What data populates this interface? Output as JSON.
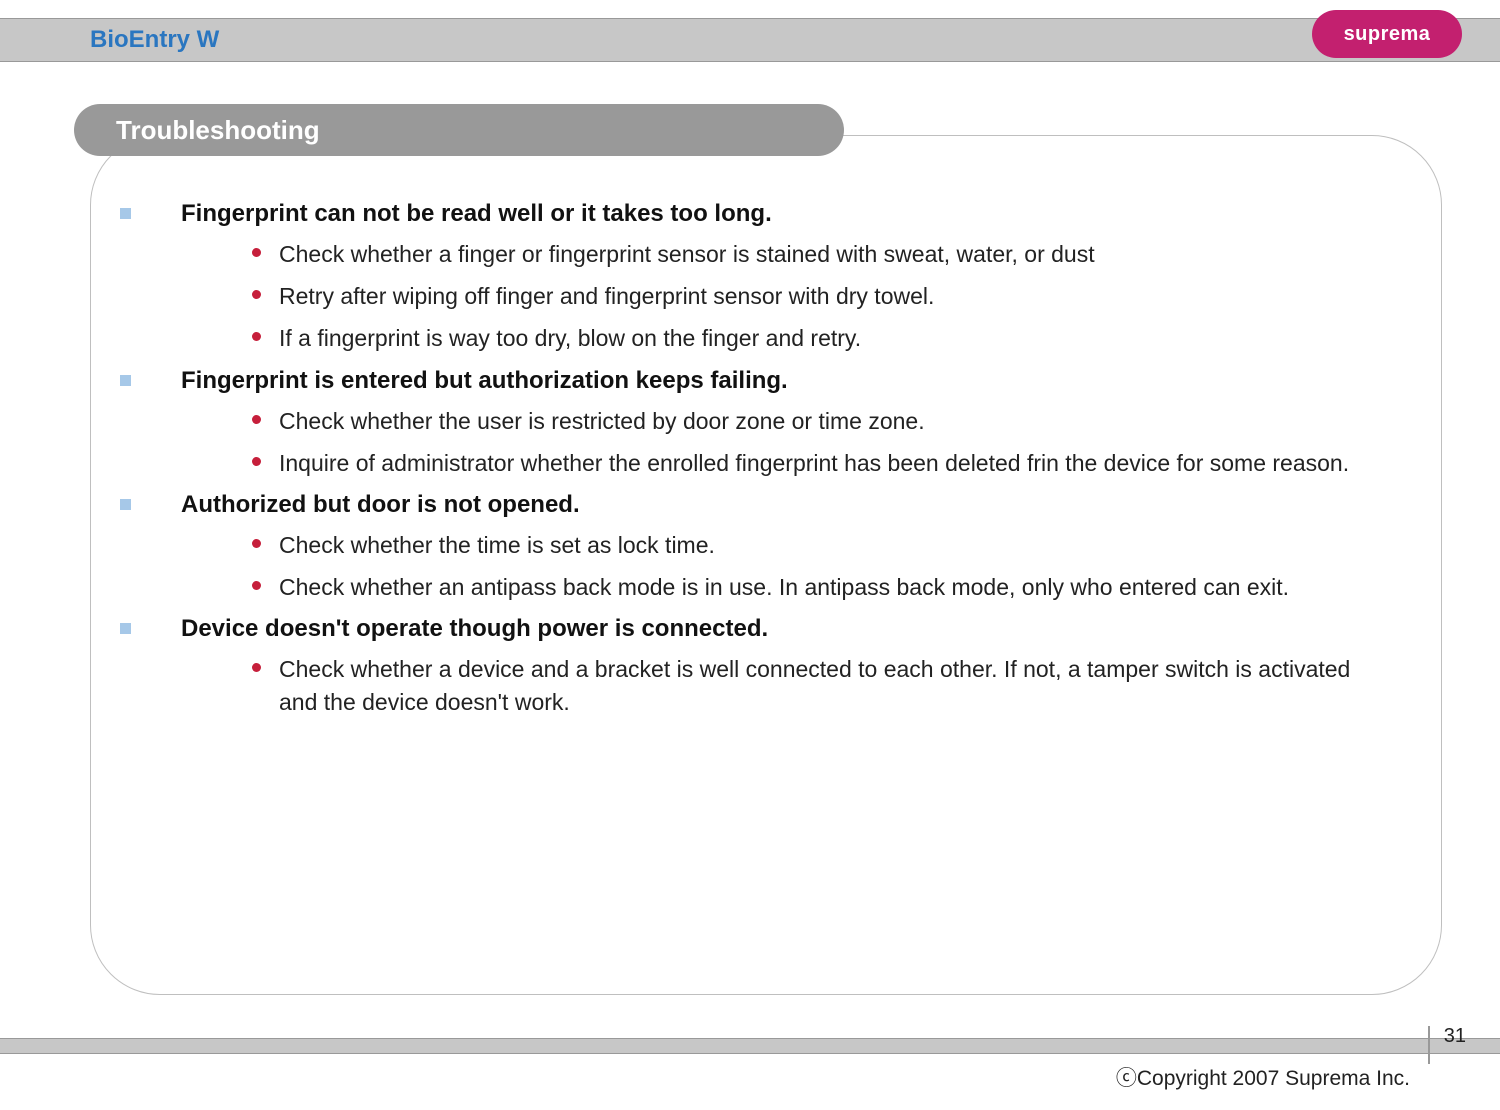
{
  "header": {
    "title": "BioEntry W",
    "logo_text": "suprema"
  },
  "section": {
    "title": "Troubleshooting"
  },
  "topics": [
    {
      "title": "Fingerprint can not be read well or it takes too long.",
      "items": [
        "Check whether a finger or fingerprint sensor is stained with sweat, water, or dust",
        "Retry after wiping off finger and fingerprint sensor with dry towel.",
        "If a fingerprint is way too dry, blow on the finger and retry."
      ]
    },
    {
      "title": "Fingerprint is entered but authorization keeps failing.",
      "items": [
        "Check whether the user is restricted by door zone or time zone.",
        "Inquire of administrator whether the enrolled fingerprint has been deleted frin the device for some reason."
      ]
    },
    {
      "title": "Authorized but door is not opened.",
      "items": [
        "Check whether the time is set as lock time.",
        "Check whether an antipass back mode is in use. In antipass back mode, only who entered can exit."
      ]
    },
    {
      "title": "Device doesn't operate though power is connected.",
      "items": [
        "Check whether a device and a bracket is well connected to each other. If not, a tamper switch is activated and the device doesn't work."
      ]
    }
  ],
  "footer": {
    "page_number": "31",
    "copyright": "ⓒCopyright 2007 Suprema Inc."
  }
}
